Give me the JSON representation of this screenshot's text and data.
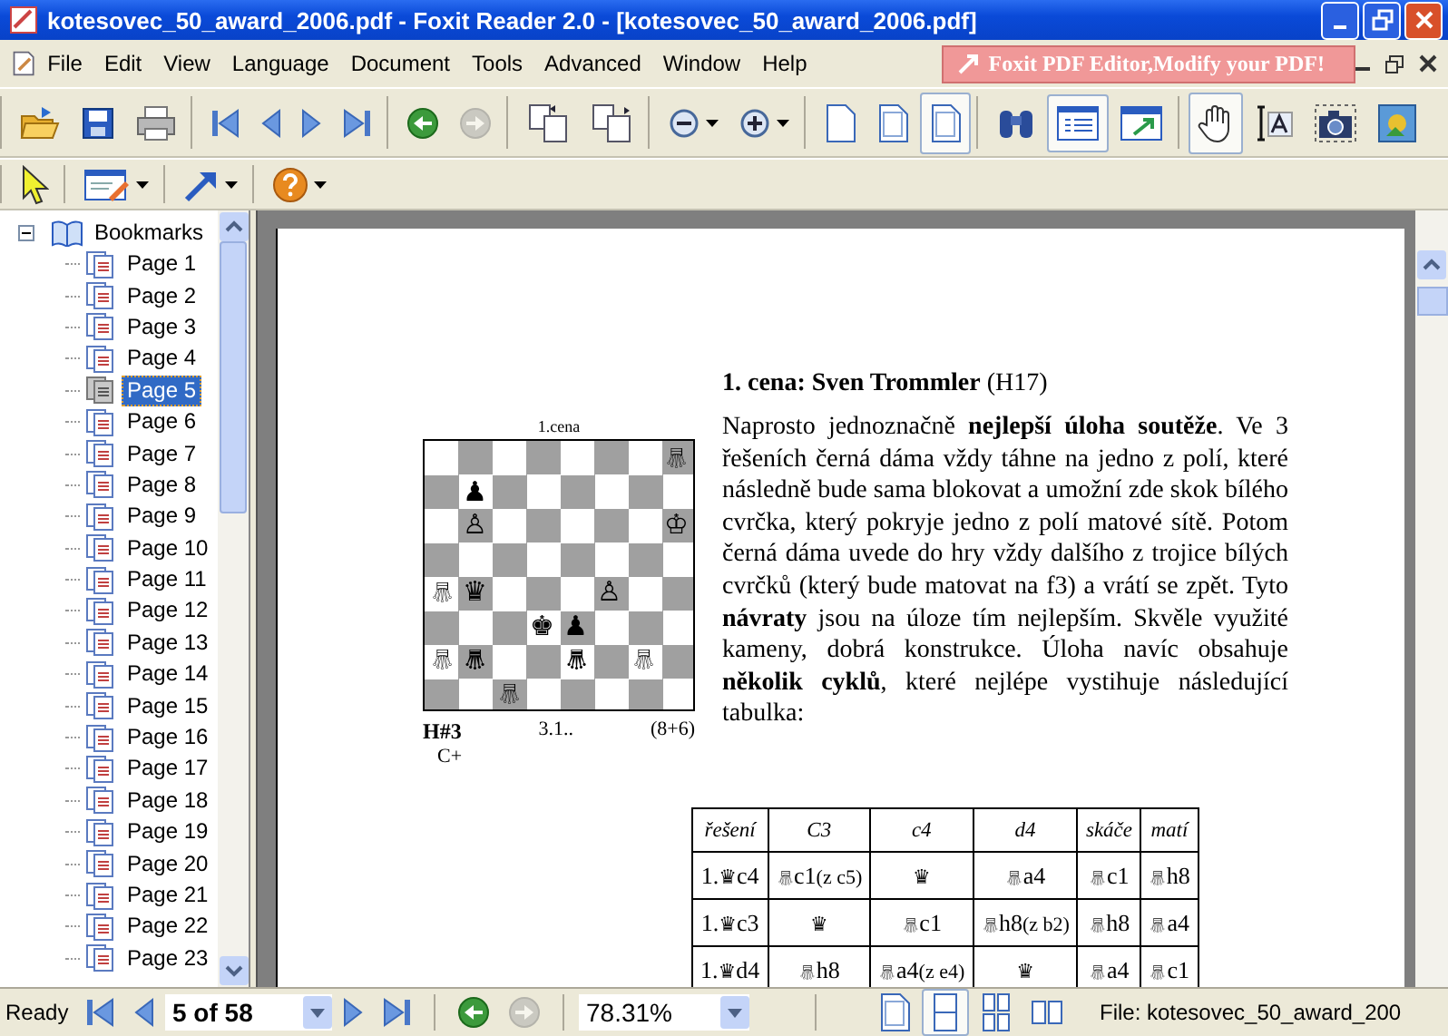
{
  "window": {
    "title": "kotesovec_50_award_2006.pdf - Foxit Reader 2.0 - [kotesovec_50_award_2006.pdf]"
  },
  "menu": [
    "File",
    "Edit",
    "View",
    "Language",
    "Document",
    "Tools",
    "Advanced",
    "Window",
    "Help"
  ],
  "promo": "Foxit PDF Editor,Modify your PDF!",
  "toolbar": [
    [
      {
        "kind": "open",
        "selected": false,
        "disabled": false,
        "dropdown": false
      },
      {
        "kind": "save",
        "selected": false,
        "disabled": false,
        "dropdown": false
      },
      {
        "kind": "print",
        "selected": false,
        "disabled": false,
        "dropdown": false
      }
    ],
    [
      {
        "kind": "first",
        "selected": false,
        "disabled": false,
        "dropdown": false
      },
      {
        "kind": "prev",
        "selected": false,
        "disabled": false,
        "dropdown": false
      },
      {
        "kind": "next",
        "selected": false,
        "disabled": false,
        "dropdown": false
      },
      {
        "kind": "last",
        "selected": false,
        "disabled": false,
        "dropdown": false
      }
    ],
    [
      {
        "kind": "back",
        "selected": false,
        "disabled": false,
        "dropdown": false
      },
      {
        "kind": "forward",
        "selected": false,
        "disabled": true,
        "dropdown": false
      }
    ],
    [
      {
        "kind": "rotate-left",
        "selected": false,
        "disabled": false,
        "dropdown": false
      },
      {
        "kind": "rotate-right",
        "selected": false,
        "disabled": false,
        "dropdown": false
      }
    ],
    [
      {
        "kind": "zoom-out",
        "selected": false,
        "disabled": false,
        "dropdown": true
      },
      {
        "kind": "zoom-in",
        "selected": false,
        "disabled": false,
        "dropdown": true
      }
    ],
    [
      {
        "kind": "actual-size",
        "selected": false,
        "disabled": false,
        "dropdown": false
      },
      {
        "kind": "fit-page",
        "selected": false,
        "disabled": false,
        "dropdown": false
      },
      {
        "kind": "fit-width",
        "selected": true,
        "disabled": false,
        "dropdown": false
      }
    ],
    [
      {
        "kind": "find",
        "selected": false,
        "disabled": false,
        "dropdown": false
      },
      {
        "kind": "bookmarks",
        "selected": true,
        "disabled": false,
        "dropdown": false
      },
      {
        "kind": "window",
        "selected": false,
        "disabled": false,
        "dropdown": false
      }
    ],
    [
      {
        "kind": "hand",
        "selected": true,
        "disabled": false,
        "dropdown": false
      },
      {
        "kind": "text-select",
        "selected": false,
        "disabled": false,
        "dropdown": false
      },
      {
        "kind": "snapshot",
        "selected": false,
        "disabled": false,
        "dropdown": false
      },
      {
        "kind": "image",
        "selected": false,
        "disabled": false,
        "dropdown": false
      }
    ]
  ],
  "toolbar2": [
    [
      {
        "kind": "select",
        "selected": false,
        "disabled": false,
        "dropdown": false
      }
    ],
    [
      {
        "kind": "annotate",
        "selected": false,
        "disabled": false,
        "dropdown": true
      }
    ],
    [
      {
        "kind": "arrow-tool",
        "selected": false,
        "disabled": false,
        "dropdown": true
      }
    ],
    [
      {
        "kind": "help",
        "selected": false,
        "disabled": false,
        "dropdown": true
      }
    ]
  ],
  "sidebar": {
    "label": "Bookmarks",
    "expanded": true,
    "children": [
      {
        "label": "Page 1",
        "selected": false
      },
      {
        "label": "Page 2",
        "selected": false
      },
      {
        "label": "Page 3",
        "selected": false
      },
      {
        "label": "Page 4",
        "selected": false
      },
      {
        "label": "Page 5",
        "selected": true
      },
      {
        "label": "Page 6",
        "selected": false
      },
      {
        "label": "Page 7",
        "selected": false
      },
      {
        "label": "Page 8",
        "selected": false
      },
      {
        "label": "Page 9",
        "selected": false
      },
      {
        "label": "Page 10",
        "selected": false
      },
      {
        "label": "Page 11",
        "selected": false
      },
      {
        "label": "Page 12",
        "selected": false
      },
      {
        "label": "Page 13",
        "selected": false
      },
      {
        "label": "Page 14",
        "selected": false
      },
      {
        "label": "Page 15",
        "selected": false
      },
      {
        "label": "Page 16",
        "selected": false
      },
      {
        "label": "Page 17",
        "selected": false
      },
      {
        "label": "Page 18",
        "selected": false
      },
      {
        "label": "Page 19",
        "selected": false
      },
      {
        "label": "Page 20",
        "selected": false
      },
      {
        "label": "Page 21",
        "selected": false
      },
      {
        "label": "Page 22",
        "selected": false
      },
      {
        "label": "Page 23",
        "selected": false
      }
    ]
  },
  "document": {
    "heading": "**1. cena: Sven Trommler** (H17)",
    "paragraph": "Naprosto jednoznačně **nejlepší úloha soutěže**. Ve 3 řešeních černá dáma vždy táhne na jedno z polí, které následně bude sama blokovat a umožní zde skok bílého cvrčka, který pokryje jedno z polí matové sítě. Potom černá dáma uvede do hry vždy dalšího z trojice bílých cvrčků (který bude matovat na f3) a vrátí se zpět. Tyto **návraty** jsou na úloze tím nejlepším. Skvěle využité kameny, dobrá konstrukce. Úloha navíc obsahuje **několik cyklů**, které nejlépe vystihuje následující tabulka:",
    "diagram": {
      "title": "1.cena",
      "stipulation": "H#3",
      "solutions": "3.1..",
      "count": "(8+6)",
      "note": "C+",
      "board": [
        [
          {
            "kind": "empty"
          },
          {
            "kind": "empty"
          },
          {
            "kind": "empty"
          },
          {
            "kind": "empty"
          },
          {
            "kind": "empty"
          },
          {
            "kind": "empty"
          },
          {
            "kind": "empty"
          },
          {
            "glyph": "♕",
            "kind": "grasshopper"
          }
        ],
        [
          {
            "kind": "empty"
          },
          {
            "glyph": "♟",
            "kind": "pawn"
          },
          {
            "kind": "empty"
          },
          {
            "kind": "empty"
          },
          {
            "kind": "empty"
          },
          {
            "kind": "empty"
          },
          {
            "kind": "empty"
          },
          {
            "kind": "empty"
          }
        ],
        [
          {
            "kind": "empty"
          },
          {
            "glyph": "♙",
            "kind": "pawn"
          },
          {
            "kind": "empty"
          },
          {
            "kind": "empty"
          },
          {
            "kind": "empty"
          },
          {
            "kind": "empty"
          },
          {
            "kind": "empty"
          },
          {
            "glyph": "♔",
            "kind": "king"
          }
        ],
        [
          {
            "kind": "empty"
          },
          {
            "kind": "empty"
          },
          {
            "kind": "empty"
          },
          {
            "kind": "empty"
          },
          {
            "kind": "empty"
          },
          {
            "kind": "empty"
          },
          {
            "kind": "empty"
          },
          {
            "kind": "empty"
          }
        ],
        [
          {
            "glyph": "♕",
            "kind": "grasshopper"
          },
          {
            "glyph": "♛",
            "kind": "queen"
          },
          {
            "kind": "empty"
          },
          {
            "kind": "empty"
          },
          {
            "kind": "empty"
          },
          {
            "glyph": "♙",
            "kind": "pawn"
          },
          {
            "kind": "empty"
          },
          {
            "kind": "empty"
          }
        ],
        [
          {
            "kind": "empty"
          },
          {
            "kind": "empty"
          },
          {
            "kind": "empty"
          },
          {
            "glyph": "♚",
            "kind": "king"
          },
          {
            "glyph": "♟",
            "kind": "pawn"
          },
          {
            "kind": "empty"
          },
          {
            "kind": "empty"
          },
          {
            "kind": "empty"
          }
        ],
        [
          {
            "glyph": "♕",
            "kind": "grasshopper"
          },
          {
            "glyph": "♛",
            "kind": "grasshopper"
          },
          {
            "kind": "empty"
          },
          {
            "kind": "empty"
          },
          {
            "glyph": "♛",
            "kind": "grasshopper"
          },
          {
            "kind": "empty"
          },
          {
            "glyph": "♕",
            "kind": "grasshopper"
          },
          {
            "kind": "empty"
          }
        ],
        [
          {
            "kind": "empty"
          },
          {
            "kind": "empty"
          },
          {
            "glyph": "♕",
            "kind": "grasshopper"
          },
          {
            "kind": "empty"
          },
          {
            "kind": "empty"
          },
          {
            "kind": "empty"
          },
          {
            "kind": "empty"
          },
          {
            "kind": "empty"
          }
        ]
      ]
    },
    "table": {
      "columns": [
        "řešení",
        "C3",
        "c4",
        "d4",
        "skáče",
        "matí"
      ],
      "rows": [
        [
          {
            "lead": "1.",
            "glyph": "♛",
            "kind": "queen",
            "text": "c4"
          },
          {
            "glyph": "♕",
            "kind": "grasshopper",
            "text": "c1",
            "note": "(z c5)"
          },
          {
            "glyph": "♛",
            "kind": "queen"
          },
          {
            "glyph": "♕",
            "kind": "grasshopper",
            "text": "a4"
          },
          {
            "glyph": "♕",
            "kind": "grasshopper",
            "text": "c1"
          },
          {
            "glyph": "♕",
            "kind": "grasshopper",
            "text": "h8"
          }
        ],
        [
          {
            "lead": "1.",
            "glyph": "♛",
            "kind": "queen",
            "text": "c3"
          },
          {
            "glyph": "♛",
            "kind": "queen"
          },
          {
            "glyph": "♕",
            "kind": "grasshopper",
            "text": "c1"
          },
          {
            "glyph": "♕",
            "kind": "grasshopper",
            "text": "h8",
            "note": "(z b2)"
          },
          {
            "glyph": "♕",
            "kind": "grasshopper",
            "text": "h8"
          },
          {
            "glyph": "♕",
            "kind": "grasshopper",
            "text": "a4"
          }
        ],
        [
          {
            "lead": "1.",
            "glyph": "♛",
            "kind": "queen",
            "text": "d4"
          },
          {
            "glyph": "♕",
            "kind": "grasshopper",
            "text": "h8"
          },
          {
            "glyph": "♕",
            "kind": "grasshopper",
            "text": "a4",
            "note": "(z e4)"
          },
          {
            "glyph": "♛",
            "kind": "queen"
          },
          {
            "glyph": "♕",
            "kind": "grasshopper",
            "text": "a4"
          },
          {
            "glyph": "♕",
            "kind": "grasshopper",
            "text": "c1"
          }
        ]
      ]
    }
  },
  "status_bar": {
    "text": "Ready",
    "nav": [
      {
        "kind": "first",
        "selected": false,
        "disabled": false,
        "dropdown": false
      },
      {
        "kind": "prev",
        "selected": false,
        "disabled": false,
        "dropdown": false
      }
    ],
    "page": "5 of 58",
    "nav2": [
      {
        "kind": "next",
        "selected": false,
        "disabled": false,
        "dropdown": false
      },
      {
        "kind": "last",
        "selected": false,
        "disabled": false,
        "dropdown": false
      }
    ],
    "history": [
      {
        "kind": "back",
        "selected": false,
        "disabled": false,
        "dropdown": false
      },
      {
        "kind": "forward",
        "selected": false,
        "disabled": true,
        "dropdown": false
      }
    ],
    "zoom": "78.31%",
    "views": [
      {
        "kind": "view-single",
        "selected": false,
        "disabled": false,
        "dropdown": false
      },
      {
        "kind": "view-continuous",
        "selected": true,
        "disabled": false,
        "dropdown": false
      },
      {
        "kind": "view-grid",
        "selected": false,
        "disabled": false,
        "dropdown": false
      },
      {
        "kind": "view-facing",
        "selected": false,
        "disabled": false,
        "dropdown": false
      }
    ],
    "file": "File: kotesovec_50_award_200"
  }
}
